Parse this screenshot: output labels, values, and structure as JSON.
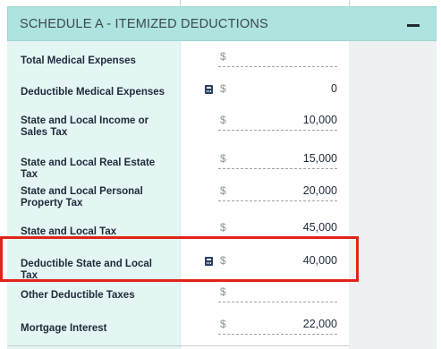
{
  "section": {
    "title": "SCHEDULE A - ITEMIZED DEDUCTIONS",
    "collapse_symbol": "minus-icon"
  },
  "currency_symbol": "$",
  "rows": [
    {
      "label": "Total Medical Expenses",
      "value": "",
      "calculated": false
    },
    {
      "label": "Deductible Medical Expenses",
      "value": "0",
      "calculated": true
    },
    {
      "label": "State and Local Income or Sales Tax",
      "value": "10,000",
      "calculated": false
    },
    {
      "label": "State and Local Real Estate Tax",
      "value": "15,000",
      "calculated": false
    },
    {
      "label": "State and Local Personal Property Tax",
      "value": "20,000",
      "calculated": false
    },
    {
      "label": "State and Local Tax",
      "value": "45,000",
      "calculated": false
    },
    {
      "label": "Deductible State and Local Tax",
      "value": "40,000",
      "calculated": true,
      "highlighted": true
    },
    {
      "label": "Other Deductible Taxes",
      "value": "",
      "calculated": false
    },
    {
      "label": "Mortgage Interest",
      "value": "22,000",
      "calculated": false
    }
  ],
  "colors": {
    "header_bg": "#aee3df",
    "label_column_bg": "#e3f6f4",
    "highlight_border": "#e2231a",
    "calc_icon": "#2b3f63"
  }
}
